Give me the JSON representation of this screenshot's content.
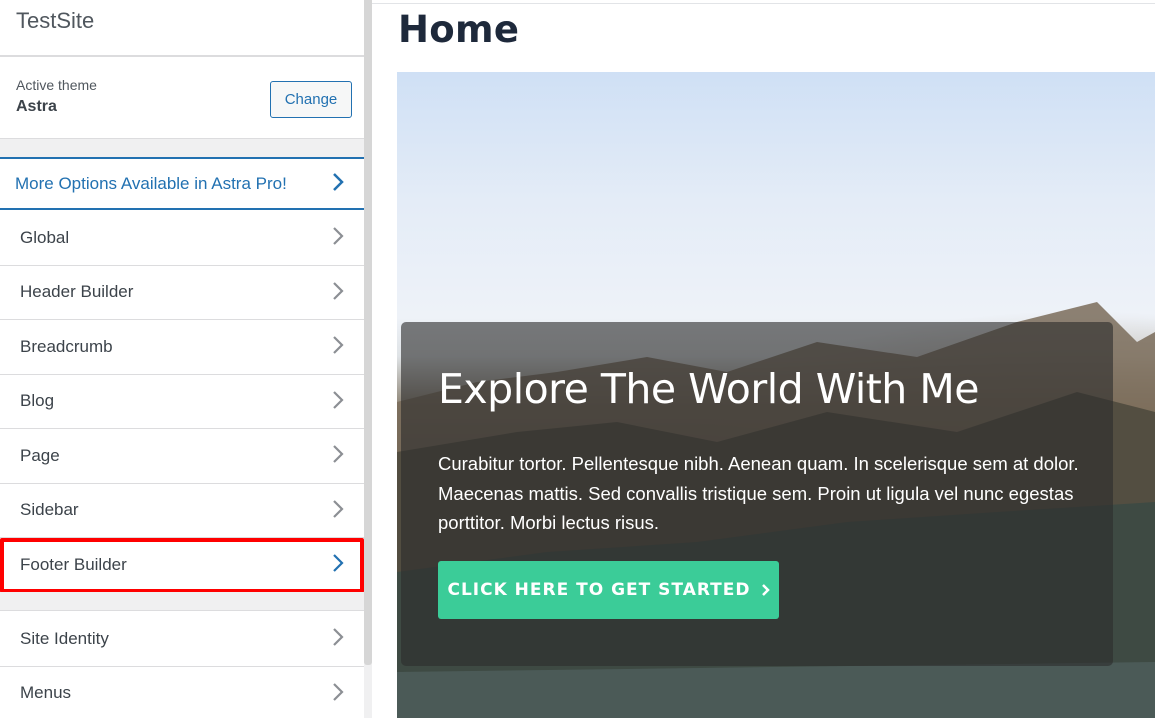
{
  "sidebar": {
    "site_title": "TestSite",
    "theme": {
      "label": "Active theme",
      "name": "Astra",
      "change_label": "Change"
    },
    "promo": {
      "label": "More Options Available in Astra Pro!",
      "icon": "chevron-right-icon"
    },
    "items": [
      {
        "label": "Global",
        "icon": "chevron-right-icon"
      },
      {
        "label": "Header Builder",
        "icon": "chevron-right-icon"
      },
      {
        "label": "Breadcrumb",
        "icon": "chevron-right-icon"
      },
      {
        "label": "Blog",
        "icon": "chevron-right-icon"
      },
      {
        "label": "Page",
        "icon": "chevron-right-icon"
      },
      {
        "label": "Sidebar",
        "icon": "chevron-right-icon"
      },
      {
        "label": "Footer Builder",
        "icon": "chevron-right-icon",
        "highlighted": true
      }
    ],
    "items2": [
      {
        "label": "Site Identity",
        "icon": "chevron-right-icon"
      },
      {
        "label": "Menus",
        "icon": "chevron-right-icon"
      }
    ]
  },
  "preview": {
    "page_title": "Home",
    "hero": {
      "heading": "Explore The World With Me",
      "text": "Curabitur tortor. Pellentesque nibh. Aenean quam. In scelerisque sem at dolor. Maecenas mattis. Sed convallis tristique sem. Proin ut ligula vel nunc egestas porttitor. Morbi lectus risus.",
      "cta_label": "CLICK HERE TO GET STARTED",
      "cta_icon": "chevron-right-icon"
    }
  },
  "colors": {
    "accent": "#2271b1",
    "highlight": "#ff0000",
    "cta": "#3bcc98",
    "text": "#3c434a"
  }
}
